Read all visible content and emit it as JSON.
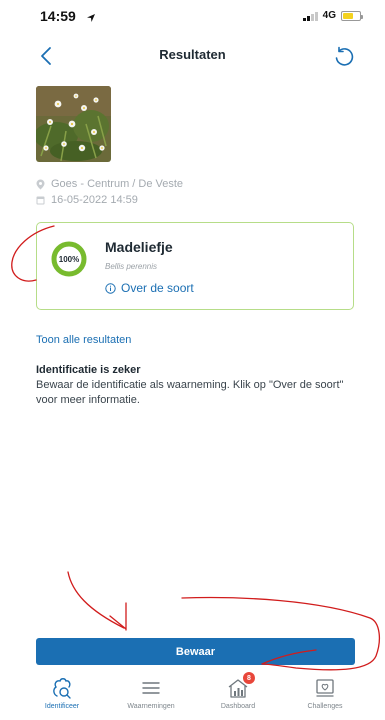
{
  "status_bar": {
    "time": "14:59",
    "network": "4G"
  },
  "header": {
    "title": "Resultaten"
  },
  "observation": {
    "location": "Goes - Centrum / De Veste",
    "datetime": "16-05-2022 14:59"
  },
  "result": {
    "score_label": "100%",
    "score_fraction": 1.0,
    "name": "Madeliefje",
    "latin": "Bellis perennis",
    "about_label": "Over de soort"
  },
  "show_all_label": "Toon alle resultaten",
  "identification": {
    "title": "Identificatie is zeker",
    "text": "Bewaar de identificatie als waarneming. Klik op \"Over de soort\" voor meer informatie."
  },
  "save_label": "Bewaar",
  "tabs": [
    {
      "label": "Identificeer",
      "icon": "identify-icon",
      "active": true
    },
    {
      "label": "Waarnemingen",
      "icon": "list-icon",
      "active": false
    },
    {
      "label": "Dashboard",
      "icon": "dashboard-icon",
      "active": false,
      "badge": "8"
    },
    {
      "label": "Challenges",
      "icon": "challenges-icon",
      "active": false
    }
  ],
  "colors": {
    "accent": "#1b6fb3",
    "ring": "#78bb2e",
    "card_border": "#b6dd88",
    "badge": "#e8463a",
    "annotation": "#d11c1c"
  }
}
